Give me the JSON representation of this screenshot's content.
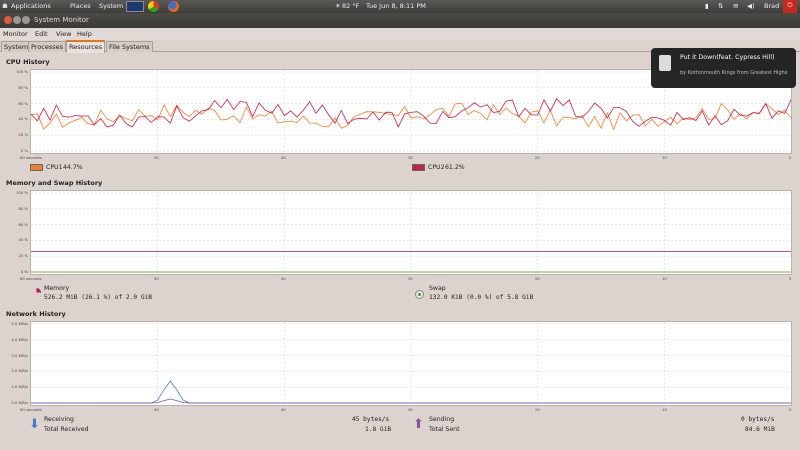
{
  "top_panel": {
    "menus": [
      "Applications",
      "Places",
      "System"
    ],
    "weather": "82 °F",
    "clock": "Tue Jun  8,  8:11 PM",
    "user": "Brad"
  },
  "window": {
    "title": "System Monitor"
  },
  "menubar": [
    "Monitor",
    "Edit",
    "View",
    "Help"
  ],
  "tabs": [
    "System",
    "Processes",
    "Resources",
    "File Systems"
  ],
  "active_tab": "Resources",
  "cpu": {
    "title": "CPU History",
    "y_ticks": [
      "100 %",
      "80 %",
      "60 %",
      "40 %",
      "20 %",
      "0 %"
    ],
    "x_ticks": [
      "60 seconds",
      "50",
      "40",
      "30",
      "20",
      "10",
      "0"
    ],
    "cpu1_label": "CPU1",
    "cpu1_value": "44.7%",
    "cpu2_label": "CPU2",
    "cpu2_value": "61.2%",
    "cpu1_color": "#f08030",
    "cpu2_color": "#c0204a"
  },
  "memory": {
    "title": "Memory and Swap History",
    "y_ticks": [
      "100 %",
      "80 %",
      "60 %",
      "40 %",
      "20 %",
      "0 %"
    ],
    "x_ticks": [
      "60 seconds",
      "50",
      "40",
      "30",
      "20",
      "10",
      "0"
    ],
    "mem_label": "Memory",
    "mem_value": "526.2 MiB (26.1 %) of 2.0 GiB",
    "swap_label": "Swap",
    "swap_value": "132.0 KiB (0.0 %) of 5.8 GiB",
    "mem_color": "#a0244a",
    "swap_color": "#4e9a06"
  },
  "network": {
    "title": "Network History",
    "y_ticks": [
      "5.0 KiB/s",
      "4.0 KiB/s",
      "3.0 KiB/s",
      "2.0 KiB/s",
      "1.0 KiB/s",
      "0.0 KiB/s"
    ],
    "x_ticks": [
      "60 seconds",
      "50",
      "40",
      "30",
      "20",
      "10",
      "0"
    ],
    "receiving_label": "Receiving",
    "receiving_value": "45 bytes/s",
    "total_received_label": "Total Received",
    "total_received_value": "1.8 GiB",
    "sending_label": "Sending",
    "sending_value": "0 bytes/s",
    "total_sent_label": "Total Sent",
    "total_sent_value": "84.6 MiB"
  },
  "notification": {
    "title": "Put it Down(feat. Cypress Hill)",
    "body": "by Kottonmouth Kings from Greatest Highs"
  }
}
